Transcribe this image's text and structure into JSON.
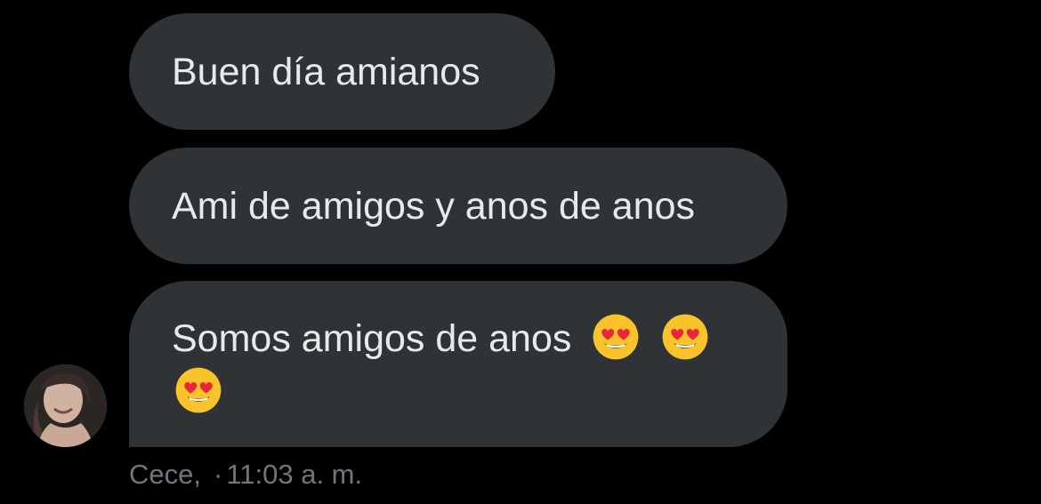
{
  "messages": [
    {
      "text": "Buen día amianos"
    },
    {
      "text": "Ami de amigos y anos de anos"
    },
    {
      "text": "Somos amigos de anos",
      "emojis": [
        "smiling-face-with-heart-eyes",
        "smiling-face-with-heart-eyes",
        "smiling-face-with-heart-eyes"
      ]
    }
  ],
  "sender": {
    "name": "Cece,",
    "separator": "·",
    "time": "11:03 a. m."
  },
  "colors": {
    "background": "#000000",
    "bubble": "#2f3336",
    "bubble_text": "#e7e9ea",
    "meta_text": "#71767b"
  }
}
